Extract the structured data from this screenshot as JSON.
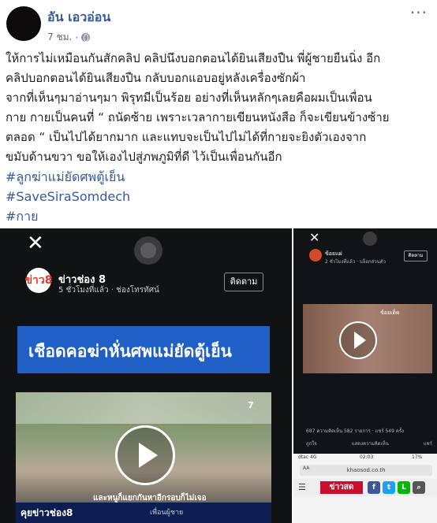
{
  "post": {
    "author": "อัน เอวอ่อน",
    "time": "7 ชม.",
    "separator": "·",
    "lines": [
      "ให้การไม่เหมือนกันสักคลิป คลิปนึงบอกตอนได้ยินเสียงปืน พี่ผู้ชายยืนนิ่ง อีก",
      "คลิปบอกตอนได้ยินเสียงปืน กลับบอกแอบอยู่หลังเครื่องซักผ้า",
      "จากที่เห็นๆมาอ่านๆมา พิรุทมีเป็นร้อย อย่างที่เห็นหลักๆเลยคือผมเป็นเพื่อน",
      "กาย กายเป็นคนที่ “ ถนัดซ้าย เพราะเวลากายเขียนหนังสือ ก็จะเขียนข้างซ้าย",
      "ตลอด “ เป็นไปได้ยากมาก และแทบจะเป็นไปไม่ได้ที่กายจะยิงตัวเองจาก",
      "ขมับด้านขวา ขอให้เองไปสู่ภพภูมิที่ดี ไว้เป็นเพื่อนกันอีก"
    ],
    "hashtags": [
      "#ลูกฆ่าแม่ยัดศพตู้เย็น",
      "#SaveSiraSomdech",
      "#กาย"
    ]
  },
  "video_left": {
    "channel_logo": "ข่าว8",
    "channel_name": "ข่าวช่อง 8",
    "channel_sub": "5 ชั่วโมงที่แล้ว · ช่องโทรทัศน์",
    "follow_label": "ติดตาม",
    "banner_title": "เชือดคอฆ่าหั่นศพแม่ยัดตู้เย็น",
    "caption": "และหนูก็แยกกันหาอีกรอบก็ไม่เจอ",
    "ticker_logo": "คุยข่าวช่อง8",
    "ticker_sub": "เพื่อนผู้ชาย"
  },
  "video_right": {
    "name": "ข้อยแผ่",
    "sub": "2 ชั่วโมงที่แล้ว · บล็อกส่วนตัว",
    "follow_label": "ติดตาม",
    "overlay": "ข้อยเด็ด",
    "stats": "687        ความคิดเห็น 582 รายการ · แชร์ 549 ครั้ง",
    "actions": [
      "ถูกใจ",
      "แสดงความคิดเห็น",
      "แชร์"
    ],
    "carrier": "dtac 4G",
    "time": "02:03",
    "battery": "17%",
    "url_aa": "AA",
    "url": "khaosod.co.th",
    "site_logo": "ข่าวสด"
  }
}
